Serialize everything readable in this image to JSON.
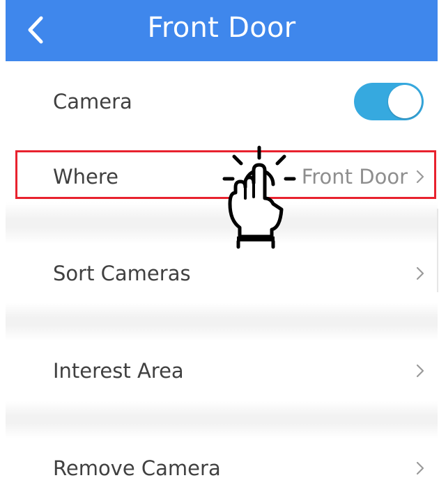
{
  "header": {
    "title": "Front Door",
    "back_icon": "chevron-left-icon",
    "color": "#3f87ec"
  },
  "settings": {
    "camera": {
      "label": "Camera",
      "toggle_on": true,
      "toggle_color": "#36a9df"
    },
    "where": {
      "label": "Where",
      "value": "Front Door",
      "highlight_color": "#e8222e"
    },
    "sort_cameras": {
      "label": "Sort Cameras"
    },
    "interest_area": {
      "label": "Interest Area"
    },
    "remove_camera": {
      "label": "Remove Camera"
    }
  },
  "overlay": {
    "pointer_icon": "tap-hand-icon"
  }
}
